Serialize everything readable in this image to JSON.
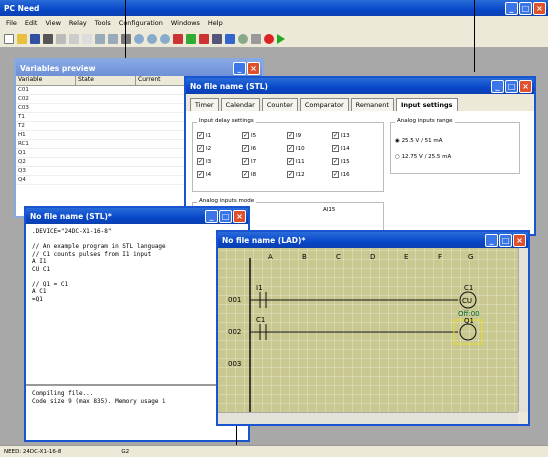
{
  "app": {
    "title": "PC Need",
    "menu": [
      "File",
      "Edit",
      "View",
      "Relay",
      "Tools",
      "Configuration",
      "Windows",
      "Help"
    ]
  },
  "status": {
    "device": "NEED: 24DC-X1-16-8",
    "field": "G2"
  },
  "vars": {
    "title": "Variables preview",
    "columns": [
      "Variable",
      "State",
      "Current"
    ],
    "rows": [
      "C01",
      "C02",
      "C03",
      "T1",
      "T2",
      "H1",
      "RC1",
      "Q1",
      "Q2",
      "Q3",
      "Q4"
    ]
  },
  "stl_settings": {
    "title": "No file name (STL)",
    "tabs": [
      "Timer",
      "Calendar",
      "Counter",
      "Comparator",
      "Remanent",
      "Input settings"
    ],
    "delay_title": "Input delay settings",
    "inputs": [
      "I1",
      "I5",
      "I9",
      "I13",
      "I2",
      "I6",
      "I10",
      "I14",
      "I3",
      "I7",
      "I11",
      "I15",
      "I4",
      "I8",
      "I12",
      "I16"
    ],
    "range_title": "Analog inputs range",
    "range_opts": [
      "25.5 V / 51 mA",
      "12.75 V / 25.5 mA"
    ],
    "mode_title": "Analog inputs mode",
    "ai_label": "AI15"
  },
  "stl": {
    "title": "No file name (STL)*",
    "code": ".DEVICE=\"24DC-X1-16-8\"\n\n// An example program in STL language\n// C1 counts pulses from I1 input\nA I1\nCU C1\n\n// Q1 = C1\nA C1\n=Q1",
    "output": "Compiling file...\nCode size 9 (max 835). Memory usage i"
  },
  "lad": {
    "title": "No file name (LAD)*",
    "cols": [
      "A",
      "B",
      "C",
      "D",
      "E",
      "F",
      "G"
    ],
    "rows": [
      "001",
      "002",
      "003"
    ],
    "c1": "C1",
    "cu": "CU",
    "off": "Off:00",
    "q1": "Q1",
    "i1": "I1",
    "c1b": "C1"
  }
}
